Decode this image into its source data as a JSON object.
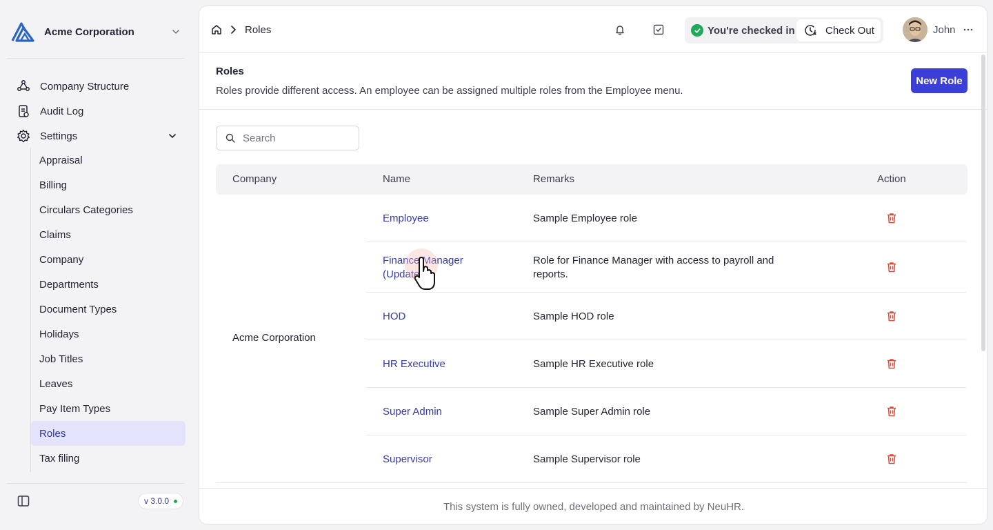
{
  "sidebar": {
    "company_name": "Acme Corporation",
    "nav": [
      {
        "label": "Company Structure",
        "icon": "hierarchy-icon"
      },
      {
        "label": "Audit Log",
        "icon": "audit-log-icon"
      },
      {
        "label": "Settings",
        "icon": "gear-icon",
        "expanded": true
      }
    ],
    "settings_items": [
      "Appraisal",
      "Billing",
      "Circulars Categories",
      "Claims",
      "Company",
      "Departments",
      "Document Types",
      "Holidays",
      "Job Titles",
      "Leaves",
      "Pay Item Types",
      "Roles",
      "Tax filing"
    ],
    "active_item": "Roles",
    "version": "v 3.0.0"
  },
  "topbar": {
    "breadcrumb": {
      "current": "Roles"
    },
    "check_status": "You're checked in",
    "checkout_label": "Check Out",
    "user_name": "John"
  },
  "page": {
    "title": "Roles",
    "description": "Roles provide different access. An employee can be assigned multiple roles from the Employee menu.",
    "new_button": "New Role"
  },
  "search": {
    "placeholder": "Search",
    "value": ""
  },
  "table": {
    "headers": {
      "company": "Company",
      "name": "Name",
      "remarks": "Remarks",
      "action": "Action"
    },
    "company": "Acme Corporation",
    "rows": [
      {
        "name": "Employee",
        "remarks": "Sample Employee role"
      },
      {
        "name": "Finance Manager (Updated)",
        "remarks": "Role for Finance Manager with access to payroll and reports."
      },
      {
        "name": "HOD",
        "remarks": "Sample HOD role"
      },
      {
        "name": "HR Executive",
        "remarks": "Sample HR Executive role"
      },
      {
        "name": "Super Admin",
        "remarks": "Sample Super Admin role"
      },
      {
        "name": "Supervisor",
        "remarks": "Sample Supervisor role"
      }
    ]
  },
  "footer": {
    "text": "This system is fully owned, developed and maintained by NeuHR."
  },
  "colors": {
    "accent": "#3b3fd8",
    "link": "#3438b8",
    "active_bg": "#e3e3fb",
    "delete": "#d84a3a",
    "success": "#22a85a"
  }
}
